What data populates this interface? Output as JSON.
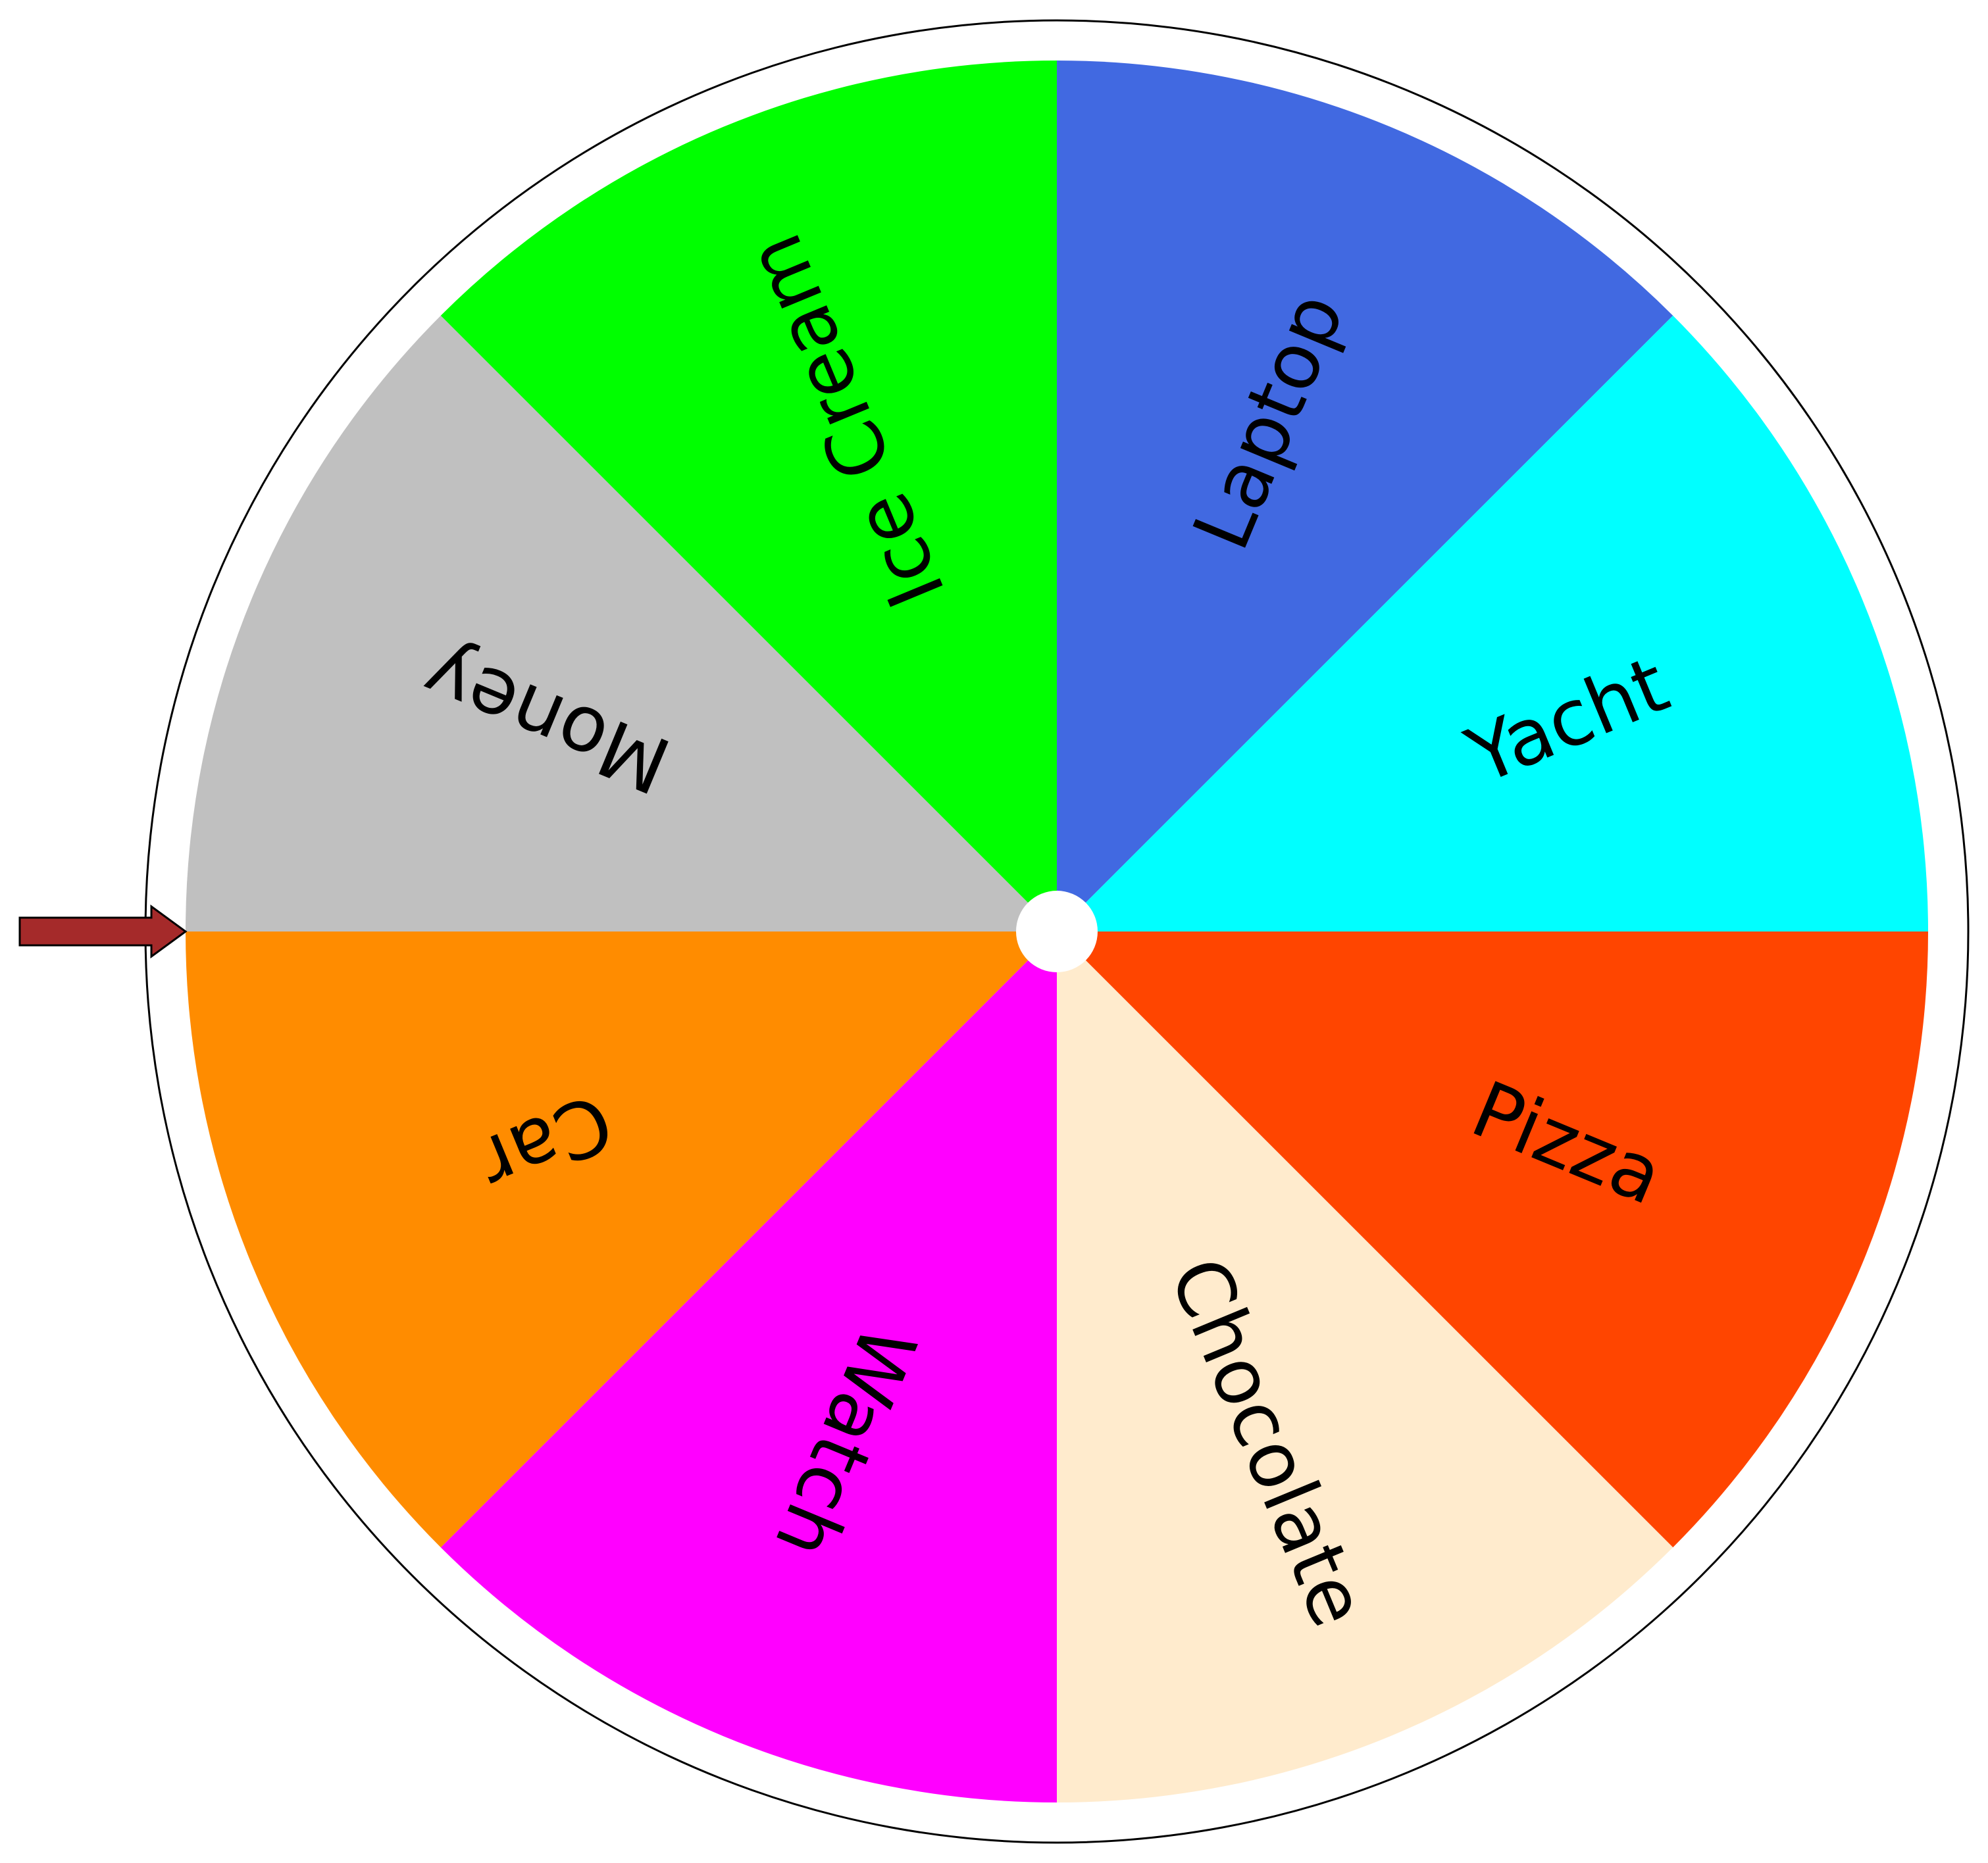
{
  "wheel": {
    "rotation_start_deg": 0,
    "direction": "clockwise",
    "segments": [
      {
        "label": "Laptop",
        "color": "#4169E1"
      },
      {
        "label": "Yacht",
        "color": "#00FFFF"
      },
      {
        "label": "Pizza",
        "color": "#FF4500"
      },
      {
        "label": "Chocolate",
        "color": "#FFEBCD"
      },
      {
        "label": "Watch",
        "color": "#FF00FF"
      },
      {
        "label": "Car",
        "color": "#FF8C00"
      },
      {
        "label": "Money",
        "color": "#C0C0C0"
      },
      {
        "label": "Ice Cream",
        "color": "#00FF00"
      }
    ],
    "rim_color": "#000000",
    "hub_color": "#ffffff"
  },
  "pointer": {
    "direction": "left",
    "color": "#A52A2A",
    "outline_color": "#000000",
    "icon": "arrow-right-icon"
  }
}
